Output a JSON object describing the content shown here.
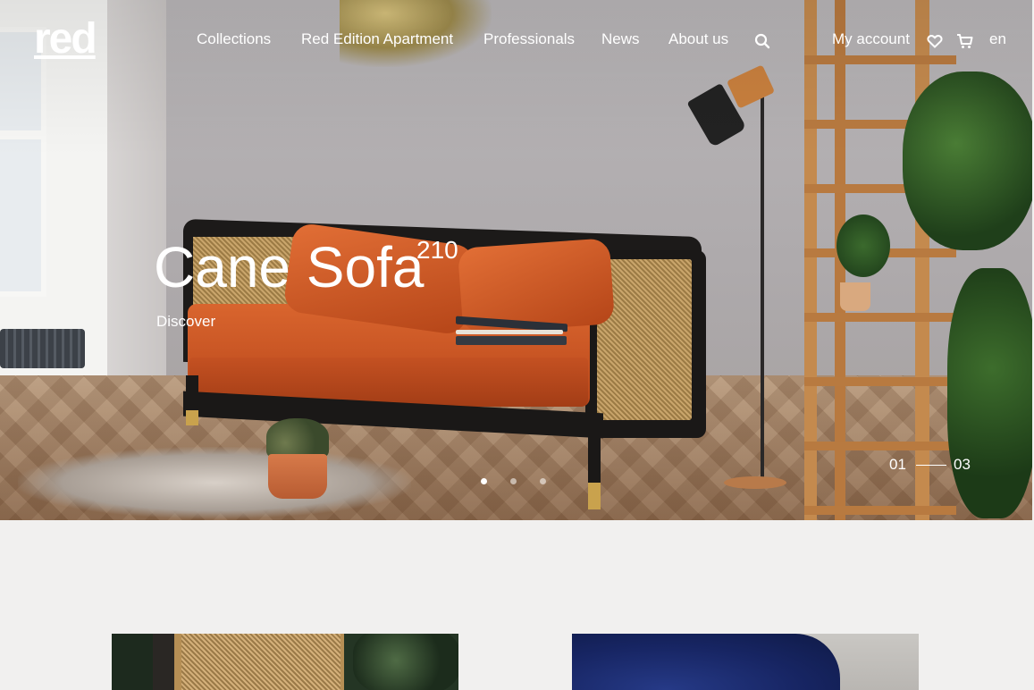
{
  "brand": {
    "logo_text": "red"
  },
  "nav": {
    "items": [
      "Collections",
      "Red Edition Apartment",
      "Professionals",
      "News",
      "About us"
    ],
    "account_label": "My account",
    "language": "en"
  },
  "icons": [
    "search-icon",
    "heart-icon",
    "cart-icon"
  ],
  "hero": {
    "title": "Cane Sofa",
    "superscript": "210",
    "cta": "Discover",
    "slide_current": "01",
    "slide_total": "03",
    "dots_count": 3,
    "active_dot": 0
  },
  "colors": {
    "text_on_image": "#ffffff",
    "page_background": "#f1f0ef"
  }
}
